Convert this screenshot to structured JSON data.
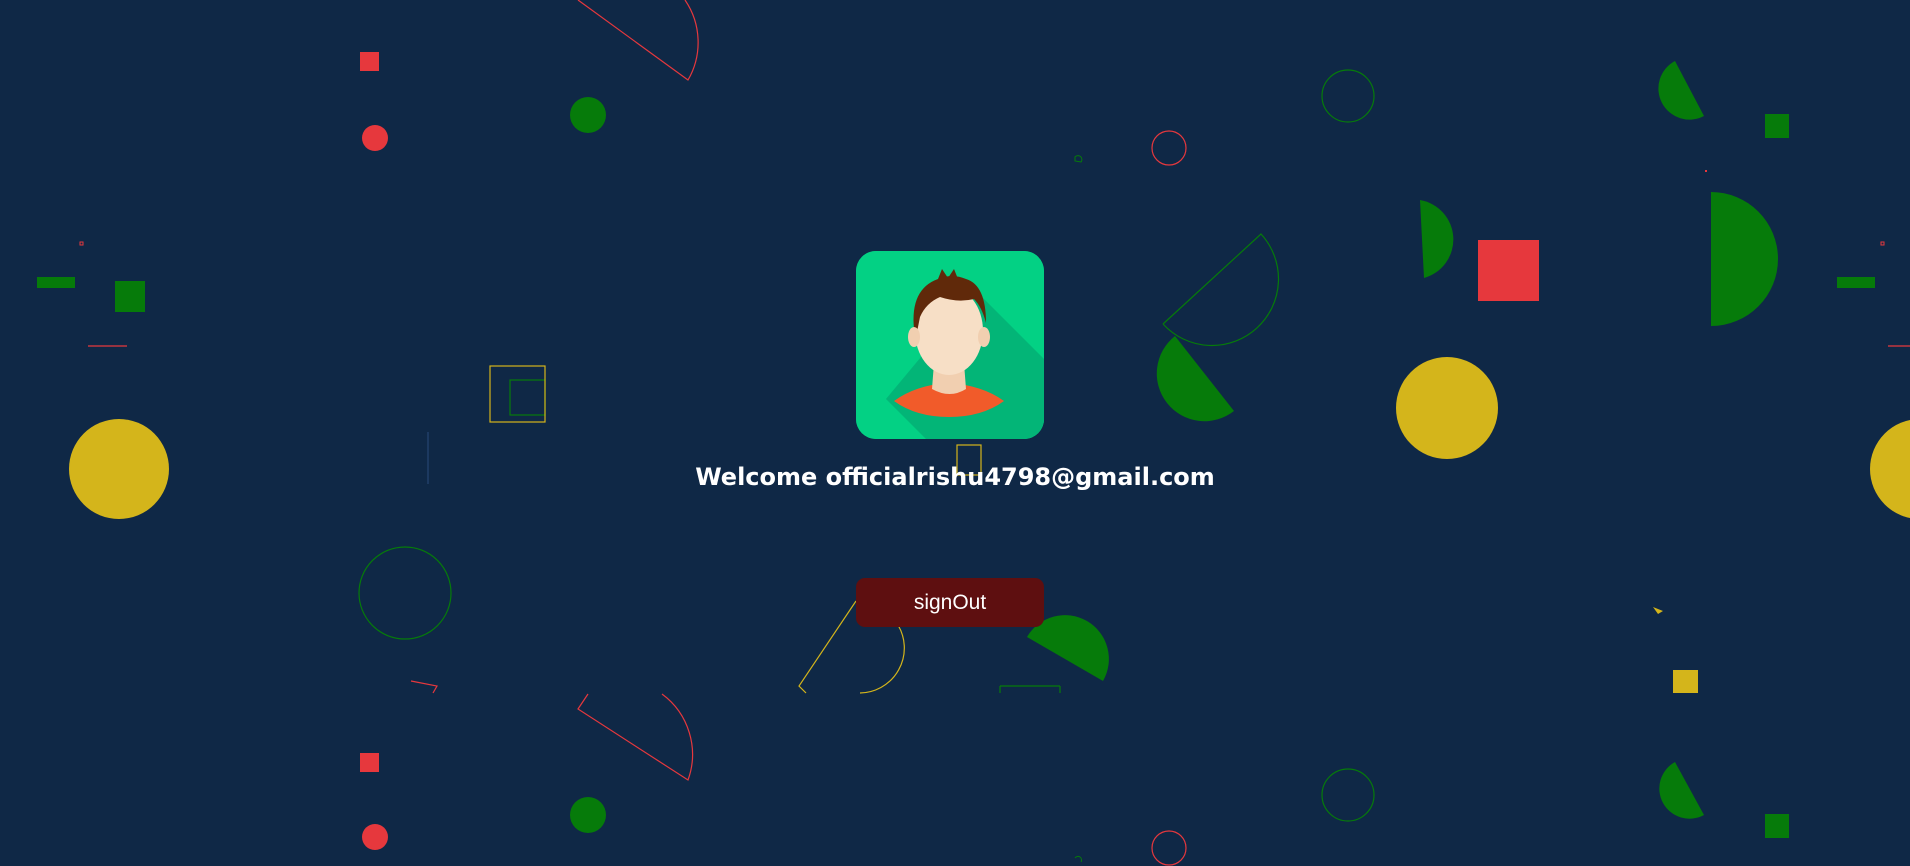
{
  "profile": {
    "avatar_icon": "user-avatar-icon",
    "avatar_bg": "#03d184",
    "welcome_prefix": "Welcome",
    "email": "officialrishu4798@gmail.com"
  },
  "actions": {
    "signout_label": "signOut"
  },
  "colors": {
    "background": "#0f2846",
    "shape_red": "#e6383d",
    "shape_green": "#067b0a",
    "shape_yellow": "#d4b51b",
    "button_bg": "#5e0f10"
  }
}
